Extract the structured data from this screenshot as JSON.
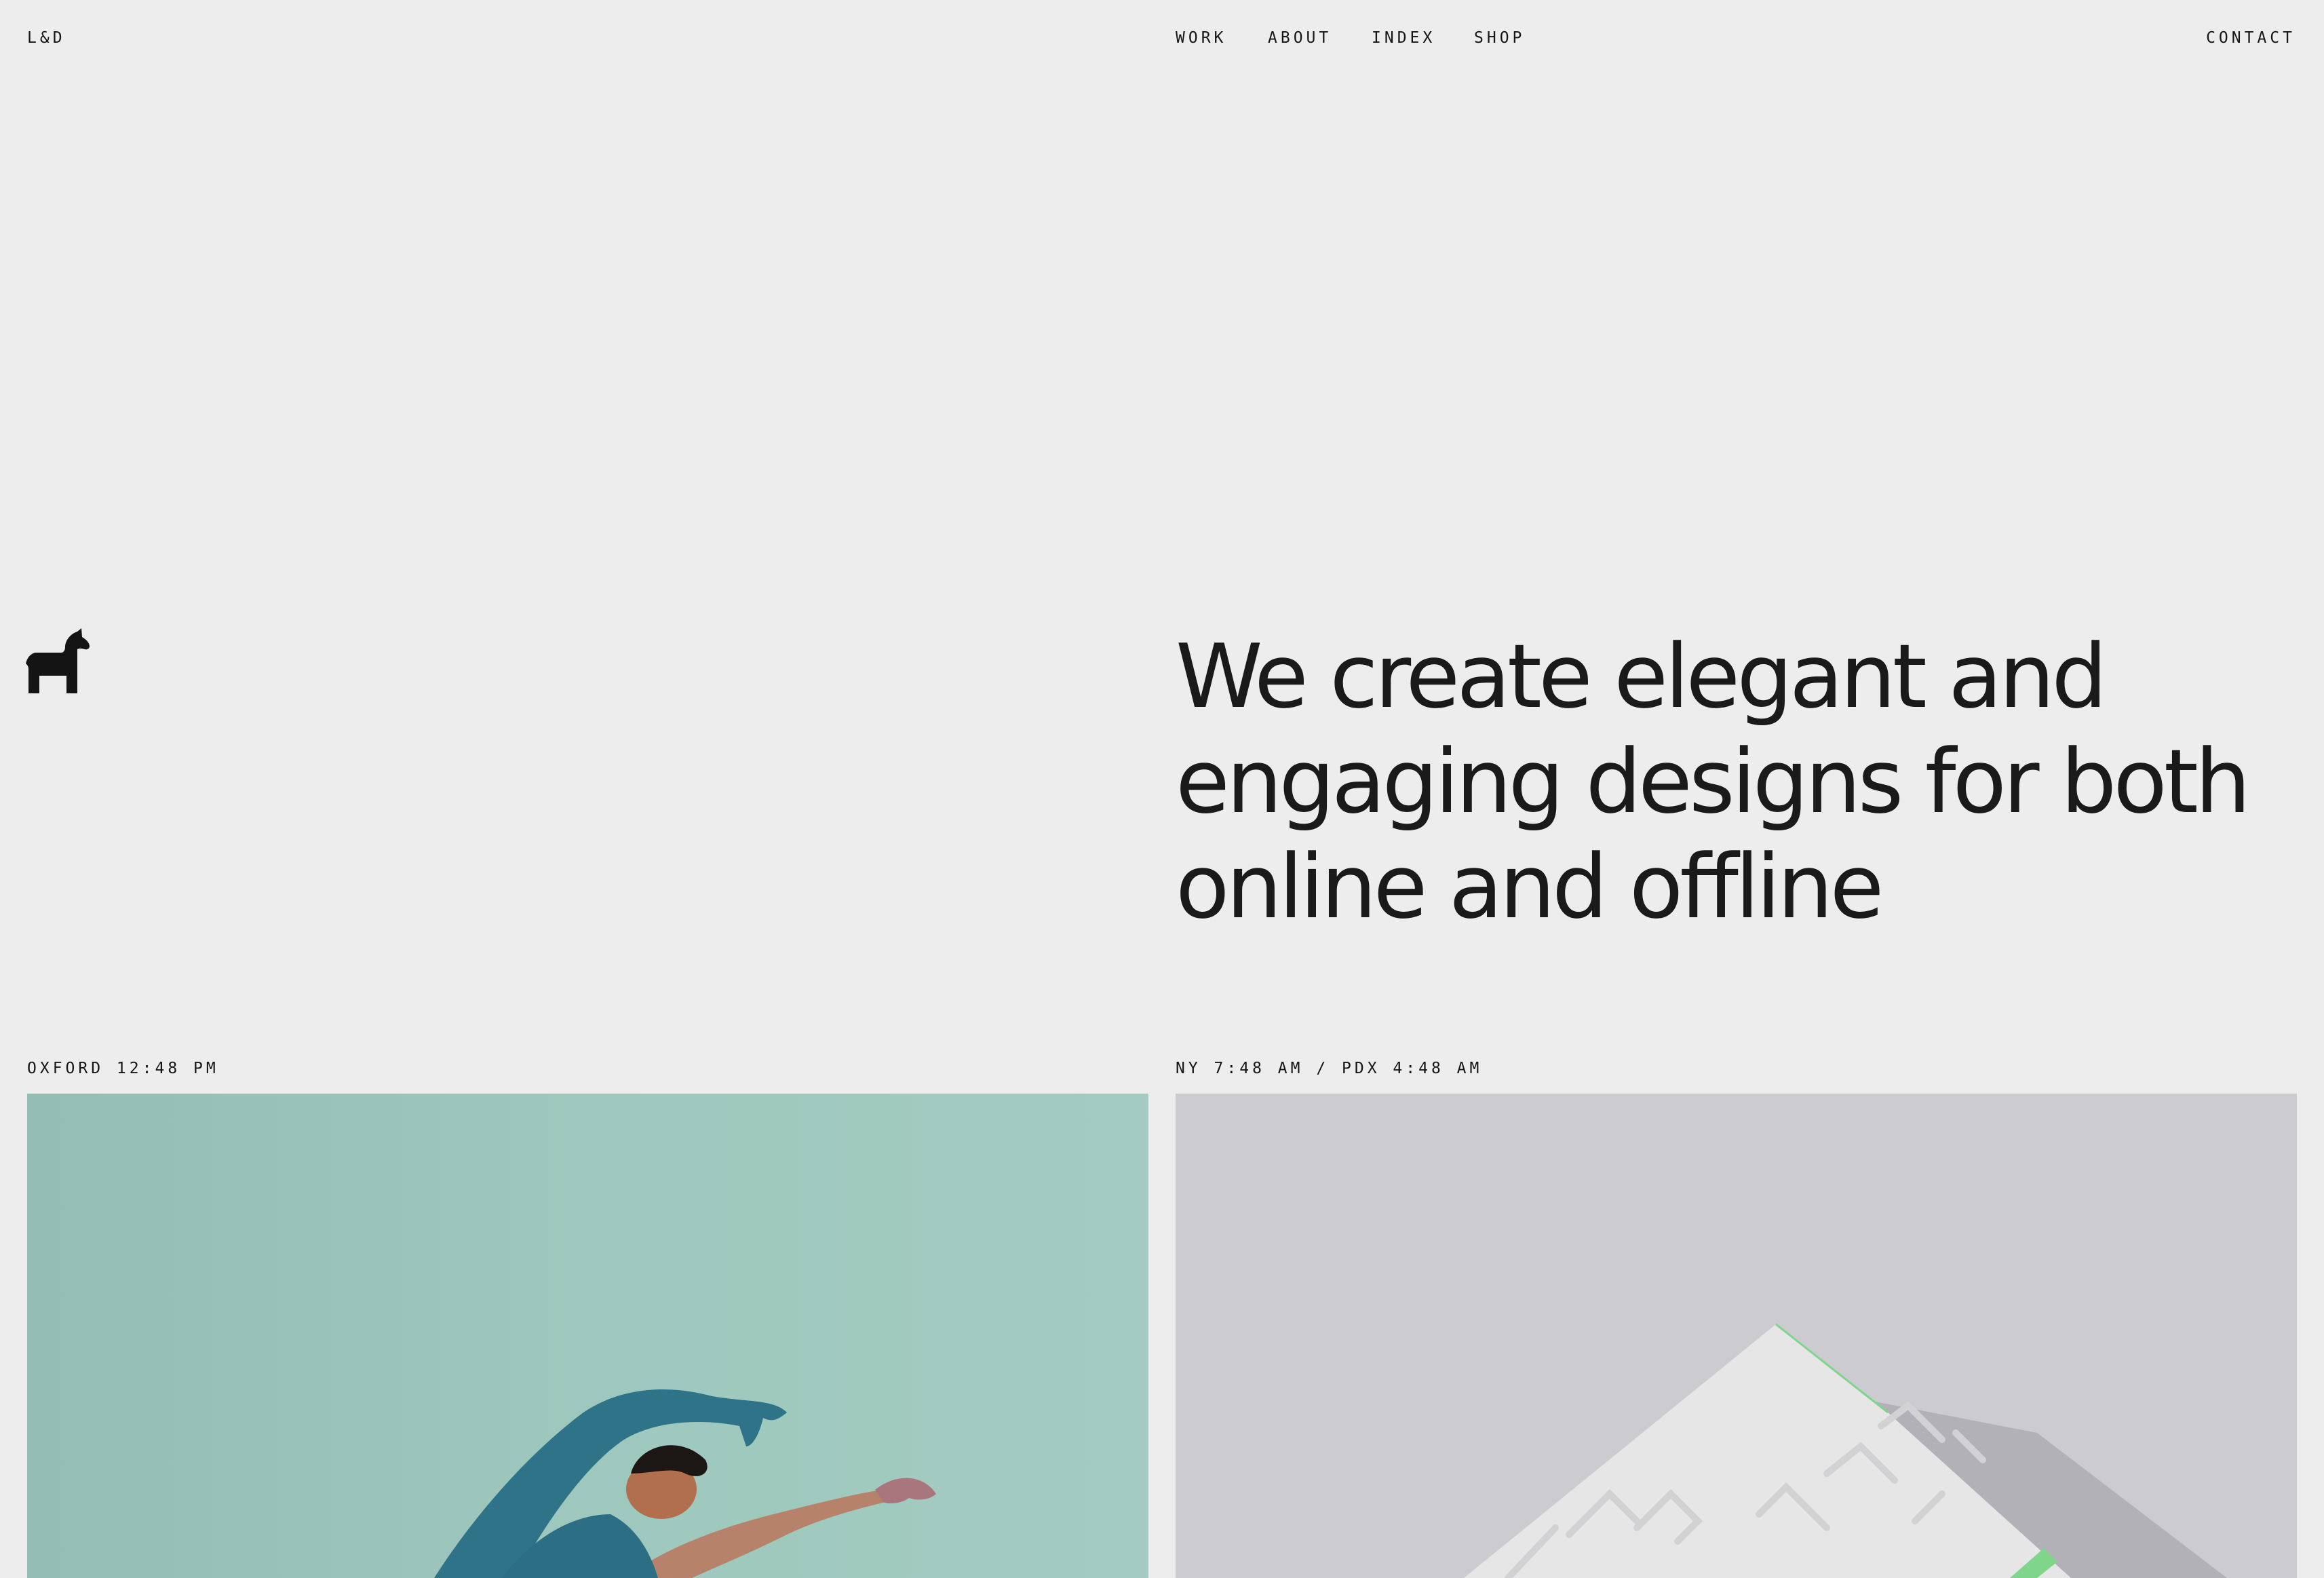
{
  "header": {
    "logo": "L&D",
    "nav": [
      "WORK",
      "ABOUT",
      "INDEX",
      "SHOP"
    ],
    "contact": "CONTACT"
  },
  "hero": {
    "icon": "horse-icon",
    "headline": "We create elegant and engaging designs for both online and offline"
  },
  "locations": {
    "left": "OXFORD 12:48 PM",
    "right": "NY 7:48 AM / PDX 4:48 AM"
  },
  "colors": {
    "background": "#ededed",
    "text": "#161616",
    "card_left": "#9ec8bd",
    "card_right": "#cccbd0"
  }
}
